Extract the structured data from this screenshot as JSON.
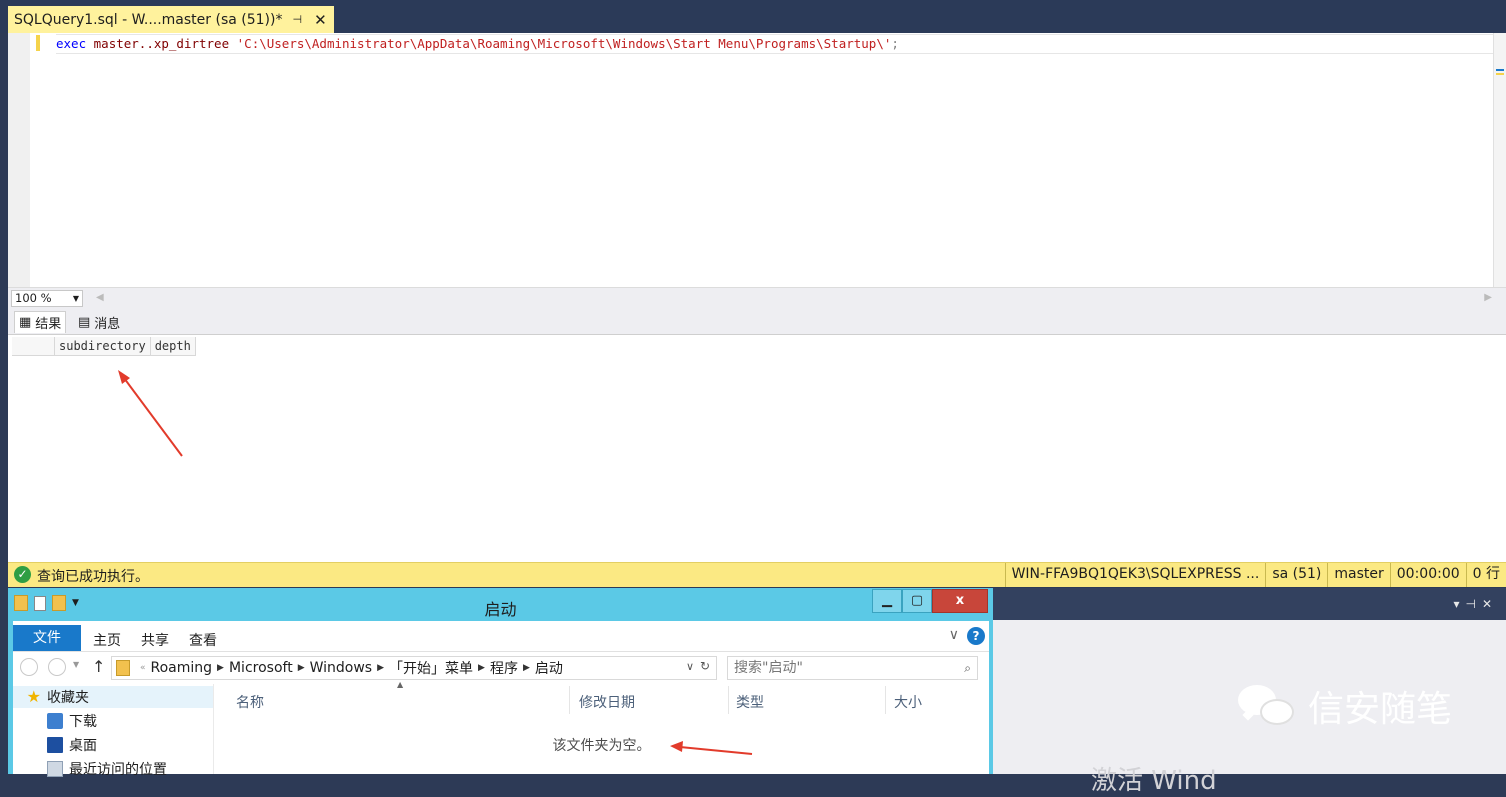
{
  "ssms": {
    "tab": {
      "title": "SQLQuery1.sql - W....master (sa (51))*",
      "pin_icon": "pin-icon",
      "close_icon": "close-icon"
    },
    "editor": {
      "code": {
        "kw": "exec",
        "obj": "master..xp_dirtree",
        "str": "'C:\\Users\\Administrator\\AppData\\Roaming\\Microsoft\\Windows\\Start Menu\\Programs\\Startup\\'",
        "end": ";"
      }
    },
    "zoom": "100 %",
    "results_tabs": [
      {
        "label": "结果",
        "icon": "grid-icon"
      },
      {
        "label": "消息",
        "icon": "messages-icon"
      }
    ],
    "grid": {
      "columns": [
        "subdirectory",
        "depth"
      ]
    },
    "status": {
      "message": "查询已成功执行。",
      "server": "WIN-FFA9BQ1QEK3\\SQLEXPRESS ...",
      "user": "sa (51)",
      "database": "master",
      "elapsed": "00:00:00",
      "rows": "0 行"
    }
  },
  "explorer": {
    "title": "启动",
    "window_buttons": {
      "minimize": "▁",
      "maximize": "▢",
      "close": "x"
    },
    "ribbon": {
      "file": "文件",
      "tabs": [
        "主页",
        "共享",
        "查看"
      ]
    },
    "address": {
      "root": "Roaming",
      "crumbs": [
        "Microsoft",
        "Windows",
        "「开始」菜单",
        "程序",
        "启动"
      ]
    },
    "search_placeholder": "搜索\"启动\"",
    "nav": [
      {
        "label": "收藏夹",
        "icon": "star-icon"
      },
      {
        "label": "下载",
        "icon": "downloads-icon"
      },
      {
        "label": "桌面",
        "icon": "desktop-icon"
      },
      {
        "label": "最近访问的位置",
        "icon": "recent-places-icon"
      }
    ],
    "columns": [
      "名称",
      "修改日期",
      "类型",
      "大小"
    ],
    "empty_message": "该文件夹为空。"
  },
  "watermark": {
    "text": "信安随笔",
    "activate_text": "激活 Wind"
  },
  "colors": {
    "tab_yellow": "#fff29d",
    "status_yellow": "#fbe983",
    "explorer_blue": "#5bc9e6",
    "annotation_red": "#e23b2b"
  }
}
